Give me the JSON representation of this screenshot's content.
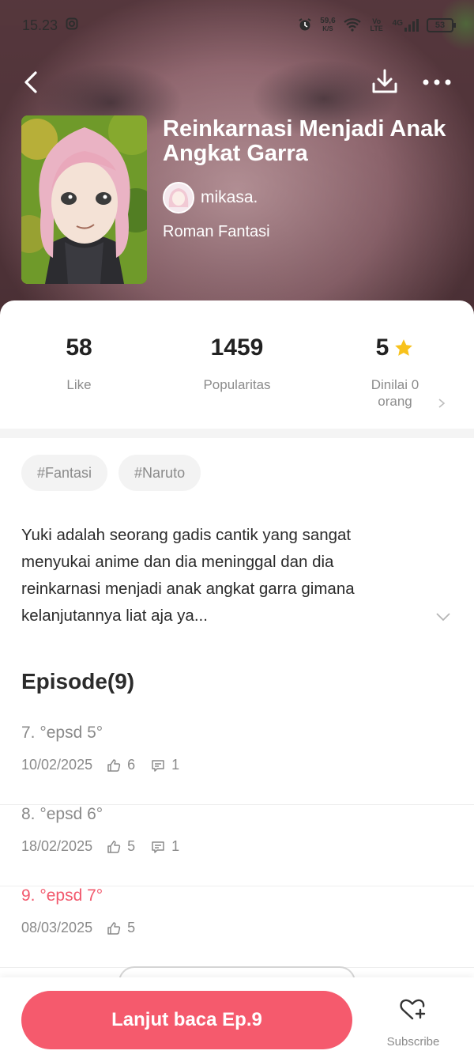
{
  "status_bar": {
    "time": "15.23",
    "net_speed_value": "59,6",
    "net_speed_unit": "K/S",
    "volte": "Vo LTE",
    "network": "4G",
    "battery": "53"
  },
  "book": {
    "title": "Reinkarnasi Menjadi Anak Angkat Garra",
    "author": "mikasa.",
    "genre": "Roman Fantasi"
  },
  "stats": {
    "like_value": "58",
    "like_label": "Like",
    "popularity_value": "1459",
    "popularity_label": "Popularitas",
    "rating_value": "5",
    "rating_label": "Dinilai 0 orang"
  },
  "tags": [
    "#Fantasi",
    "#Naruto"
  ],
  "synopsis": "Yuki adalah seorang gadis cantik yang sangat menyukai anime dan dia meninggal dan dia reinkarnasi menjadi anak angkat garra gimana kelanjutannya liat aja ya...",
  "episodes": {
    "heading": "Episode(9)",
    "items": [
      {
        "title": "7. °epsd 5°",
        "date": "10/02/2025",
        "likes": "6",
        "comments": "1"
      },
      {
        "title": "8. °epsd 6°",
        "date": "18/02/2025",
        "likes": "5",
        "comments": "1"
      },
      {
        "title": "9. °epsd 7°",
        "date": "08/03/2025",
        "likes": "5"
      }
    ]
  },
  "bottom_bar": {
    "continue_label": "Lanjut baca Ep.9",
    "subscribe_label": "Subscribe"
  },
  "colors": {
    "accent": "#f55a6d",
    "active_episode": "#f25a6e",
    "star": "#f8c21c"
  },
  "icons": [
    "camera-icon",
    "alarm-icon",
    "wifi-icon",
    "signal-icon",
    "battery-icon",
    "back-arrow-icon",
    "download-icon",
    "more-icon",
    "star-icon",
    "chevron-right-icon",
    "chevron-down-icon",
    "thumbs-up-icon",
    "comment-icon",
    "heart-plus-icon"
  ]
}
